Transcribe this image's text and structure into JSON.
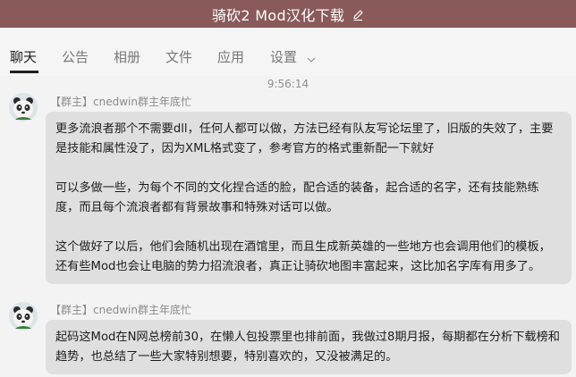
{
  "titlebar": {
    "title": "骑砍2 Mod汉化下载",
    "edit_icon": "edit-pen-icon",
    "bg_color": "#8a5a5a"
  },
  "tabs": [
    {
      "label": "聊天",
      "active": true
    },
    {
      "label": "公告",
      "active": false
    },
    {
      "label": "相册",
      "active": false
    },
    {
      "label": "文件",
      "active": false
    },
    {
      "label": "应用",
      "active": false
    },
    {
      "label": "设置",
      "active": false,
      "icon": "chevron-down-icon"
    }
  ],
  "chat": {
    "timestamp": "9:56:14",
    "messages": [
      {
        "sender": "【群主】cnedwin群主年底忙",
        "avatar_icon": "panda-avatar-icon",
        "paragraphs": [
          "更多流浪者那个不需要dll，任何人都可以做，方法已经有队友写论坛里了，旧版的失效了，主要是技能和属性没了，因为XML格式变了，参考官方的格式重新配一下就好",
          "可以多做一些，为每个不同的文化捏合适的脸，配合适的装备，起合适的名字，还有技能熟练度，而且每个流浪者都有背景故事和特殊对话可以做。",
          "这个做好了以后，他们会随机出现在酒馆里，而且生成新英雄的一些地方也会调用他们的模板，还有些Mod也会让电脑的势力招流浪者，真正让骑砍地图丰富起来，这比加名字库有用多了。"
        ]
      },
      {
        "sender": "【群主】cnedwin群主年底忙",
        "avatar_icon": "panda-avatar-icon",
        "paragraphs": [
          "起码这Mod在N网总榜前30，在懒人包投票里也排前面，我做过8期月报，每期都在分析下载榜和趋势，也总结了一些大家特别想要，特别喜欢的，又没被满足的。"
        ]
      }
    ]
  }
}
